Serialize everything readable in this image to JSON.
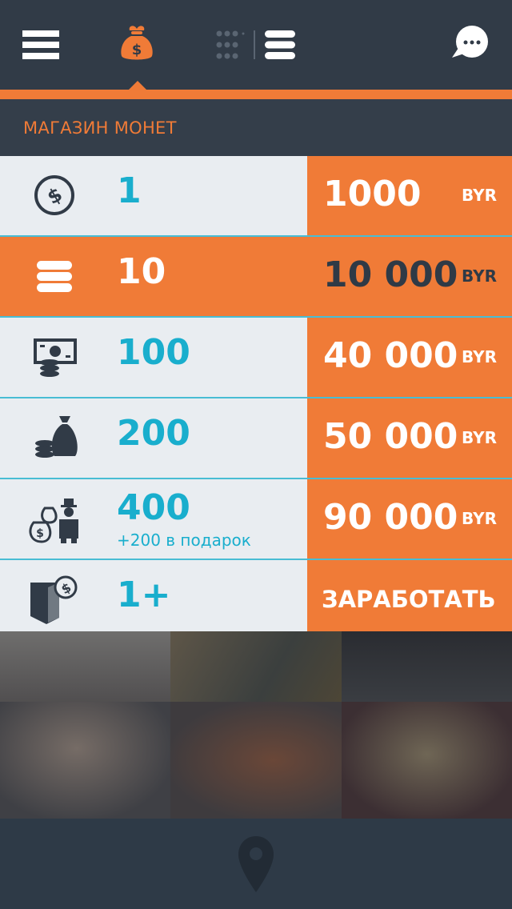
{
  "header": {
    "menu_icon": "hamburger-icon",
    "wallet_icon": "money-bag-icon",
    "view_toggle_icons": [
      "grid-icon",
      "list-icon"
    ],
    "chat_icon": "chat-bubble-icon"
  },
  "section": {
    "title": "МАГАЗИН МОНЕТ"
  },
  "offers": [
    {
      "icon": "coin-icon",
      "quantity": "1",
      "price": "1000",
      "currency": "BYR",
      "active": false
    },
    {
      "icon": "coin-stack-icon",
      "quantity": "10",
      "price": "10 000",
      "currency": "BYR",
      "active": true
    },
    {
      "icon": "banknote-coins-icon",
      "quantity": "100",
      "price": "40 000",
      "currency": "BYR",
      "active": false
    },
    {
      "icon": "sack-coins-icon",
      "quantity": "200",
      "price": "50 000",
      "currency": "BYR",
      "active": false
    },
    {
      "icon": "rich-man-bags-icon",
      "quantity": "400",
      "bonus": "+200 в подарок",
      "price": "90 000",
      "currency": "BYR",
      "active": false
    },
    {
      "icon": "wallet-coin-icon",
      "quantity": "1+",
      "action": "ЗАРАБОТАТЬ",
      "active": false
    }
  ],
  "footer": {
    "icon": "location-pin-icon"
  },
  "colors": {
    "accent": "#f07b37",
    "dark": "#313b47",
    "cyan": "#19aecd",
    "light_row": "#e9edf1"
  }
}
